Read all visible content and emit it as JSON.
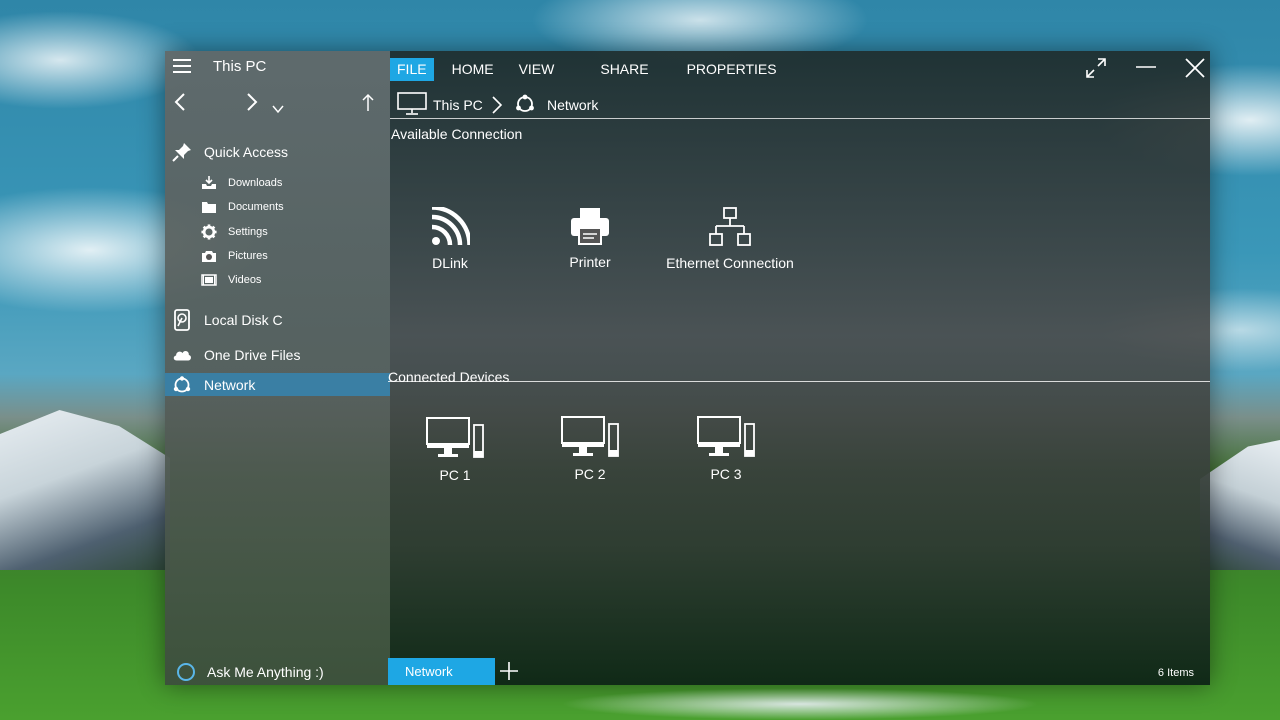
{
  "sidebar": {
    "title": "This PC",
    "quick_access": "Quick Access",
    "sub_items": [
      {
        "label": "Downloads",
        "icon": "download-tray-icon"
      },
      {
        "label": "Documents",
        "icon": "folder-icon"
      },
      {
        "label": "Settings",
        "icon": "gear-icon"
      },
      {
        "label": "Pictures",
        "icon": "camera-icon"
      },
      {
        "label": "Videos",
        "icon": "film-icon"
      }
    ],
    "local_disk": "Local Disk C",
    "one_drive": "One Drive Files",
    "network": "Network",
    "ask": "Ask Me Anything :)"
  },
  "menu": {
    "items": [
      "FILE",
      "HOME",
      "VIEW",
      "SHARE",
      "PROPERTIES"
    ],
    "active": "FILE"
  },
  "breadcrumb": {
    "pc": "This PC",
    "network": "Network"
  },
  "sections": {
    "available": "Available Connection",
    "connected": "Connected Devices"
  },
  "connections": [
    {
      "label": "DLink",
      "icon": "wifi-icon"
    },
    {
      "label": "Printer",
      "icon": "printer-icon"
    },
    {
      "label": "Ethernet Connection",
      "icon": "ethernet-network-icon"
    }
  ],
  "devices": [
    {
      "label": "PC 1",
      "icon": "desktop-pc-icon"
    },
    {
      "label": "PC 2",
      "icon": "desktop-pc-icon"
    },
    {
      "label": "PC 3",
      "icon": "desktop-pc-icon"
    }
  ],
  "footer": {
    "tab": "Network",
    "count": "6 Items"
  },
  "colors": {
    "accent": "#1ea7e4",
    "selection": "#3a7fa4",
    "cortana_ring": "#5ab6e8"
  }
}
